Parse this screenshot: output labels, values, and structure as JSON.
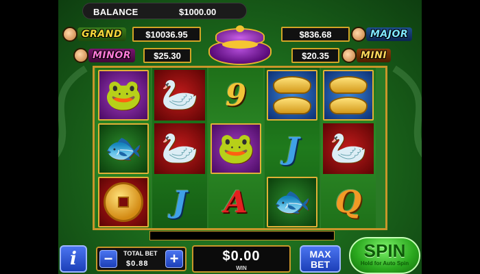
{
  "balance": {
    "label": "BALANCE",
    "value": "$1000.00"
  },
  "jackpots": {
    "grand": {
      "label": "GRAND",
      "value": "$10036.95"
    },
    "major": {
      "label": "MAJOR",
      "value": "$836.68"
    },
    "minor": {
      "label": "MINOR",
      "value": "$25.30"
    },
    "mini": {
      "label": "MINI",
      "value": "$20.35"
    }
  },
  "reels": [
    [
      {
        "symbol": "toad-icon",
        "bg": "purple"
      },
      {
        "symbol": "koi-fish-icon",
        "bg": "green"
      },
      {
        "symbol": "gold-coin-icon",
        "bg": "red"
      }
    ],
    [
      {
        "symbol": "crane-icon",
        "bg": "red"
      },
      {
        "symbol": "crane-icon",
        "bg": "red"
      },
      {
        "symbol": "letter",
        "text": "J",
        "color": "blue"
      }
    ],
    [
      {
        "symbol": "letter",
        "text": "9",
        "color": "gold"
      },
      {
        "symbol": "toad-icon",
        "bg": "purple"
      },
      {
        "symbol": "letter",
        "text": "A",
        "color": "red"
      }
    ],
    [
      {
        "symbol": "gold-ingot-icon",
        "bg": "blue"
      },
      {
        "symbol": "letter",
        "text": "J",
        "color": "blue"
      },
      {
        "symbol": "koi-fish-icon",
        "bg": "green"
      }
    ],
    [
      {
        "symbol": "gold-ingot-icon",
        "bg": "blue"
      },
      {
        "symbol": "crane-icon",
        "bg": "red"
      },
      {
        "symbol": "letter",
        "text": "Q",
        "color": "orange"
      }
    ]
  ],
  "controls": {
    "info_label": "i",
    "total_bet_label": "TOTAL BET",
    "total_bet_value": "$0.88",
    "minus_label": "−",
    "plus_label": "+",
    "win_value": "$0.00",
    "win_label": "WIN",
    "max_bet_line1": "MAX",
    "max_bet_line2": "BET",
    "spin_label": "SPIN",
    "spin_sub": "Hold for Auto Spin"
  },
  "colors": {
    "accent_gold": "#c9962a",
    "table_green": "#2a7a26",
    "button_blue": "#1c3fb8",
    "spin_green": "#2aa81e"
  }
}
